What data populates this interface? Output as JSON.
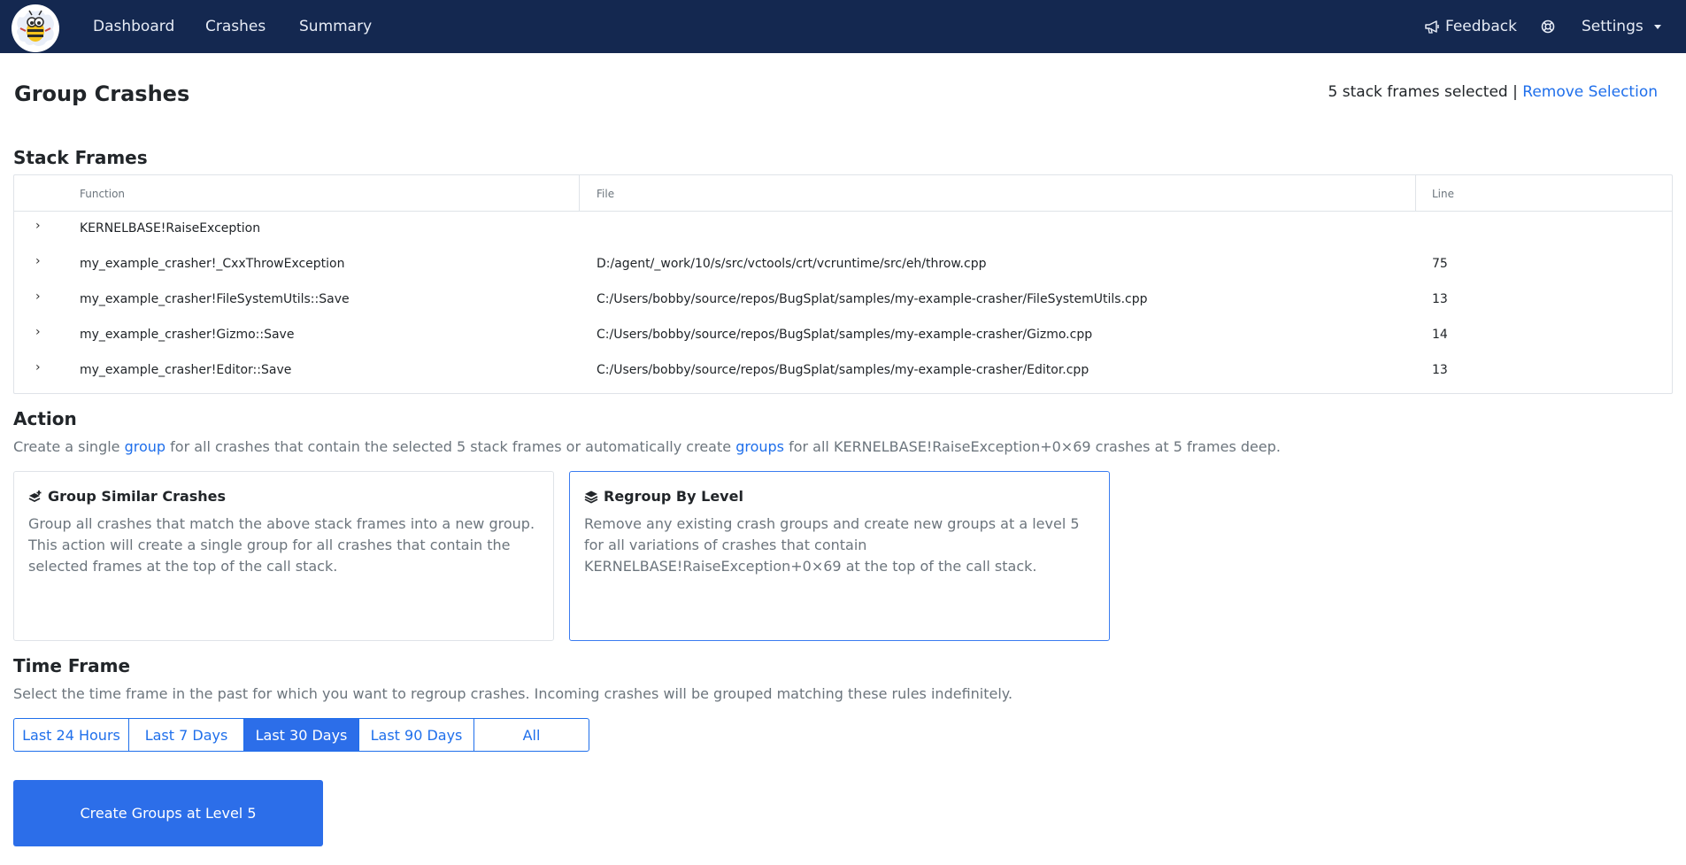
{
  "nav": {
    "logo_icon": "bugsplat-logo-icon",
    "items": [
      {
        "label": "Dashboard"
      },
      {
        "label": "Crashes"
      },
      {
        "label": "Summary"
      }
    ],
    "feedback_label": "Feedback",
    "help_icon": "lifebuoy-icon",
    "settings_label": "Settings"
  },
  "header": {
    "title": "Group Crashes",
    "selection_text": "5 stack frames selected |",
    "remove_selection_label": "Remove Selection"
  },
  "stack_frames": {
    "title": "Stack Frames",
    "columns": {
      "function": "Function",
      "file": "File",
      "line": "Line"
    },
    "rows": [
      {
        "function": "KERNELBASE!RaiseException",
        "file": "",
        "line": ""
      },
      {
        "function": "my_example_crasher!_CxxThrowException",
        "file": "D:/agent/_work/10/s/src/vctools/crt/vcruntime/src/eh/throw.cpp",
        "line": "75"
      },
      {
        "function": "my_example_crasher!FileSystemUtils::Save",
        "file": "C:/Users/bobby/source/repos/BugSplat/samples/my-example-crasher/FileSystemUtils.cpp",
        "line": "13"
      },
      {
        "function": "my_example_crasher!Gizmo::Save",
        "file": "C:/Users/bobby/source/repos/BugSplat/samples/my-example-crasher/Gizmo.cpp",
        "line": "14"
      },
      {
        "function": "my_example_crasher!Editor::Save",
        "file": "C:/Users/bobby/source/repos/BugSplat/samples/my-example-crasher/Editor.cpp",
        "line": "13"
      }
    ]
  },
  "action": {
    "title": "Action",
    "desc_part1": "Create a single",
    "desc_link1": "group",
    "desc_part2": "for all crashes that contain the selected 5 stack frames or automatically create",
    "desc_link2": "groups",
    "desc_part3": "for all KERNELBASE!RaiseException+0×69 crashes at 5 frames deep.",
    "cards": [
      {
        "title": "Group Similar Crashes",
        "icon": "layer-plus-icon",
        "body": "Group all crashes that match the above stack frames into a new group. This action will create a single group for all crashes that contain the selected frames at the top of the call stack.",
        "selected": false
      },
      {
        "title": "Regroup By Level",
        "icon": "layers-icon",
        "body": "Remove any existing crash groups and create new groups at a level 5 for all variations of crashes that contain KERNELBASE!RaiseException+0×69 at the top of the call stack.",
        "selected": true
      }
    ]
  },
  "time_frame": {
    "title": "Time Frame",
    "desc": "Select the time frame in the past for which you want to regroup crashes. Incoming crashes will be grouped matching these rules indefinitely.",
    "options": [
      {
        "label": "Last 24 Hours"
      },
      {
        "label": "Last 7 Days"
      },
      {
        "label": "Last 30 Days"
      },
      {
        "label": "Last 90 Days"
      },
      {
        "label": "All"
      }
    ],
    "selected": "Last 30 Days"
  },
  "submit": {
    "label": "Create Groups at Level 5"
  },
  "colors": {
    "navbar": "#142850",
    "accent": "#2c6ee9",
    "link": "#1f6feb"
  }
}
